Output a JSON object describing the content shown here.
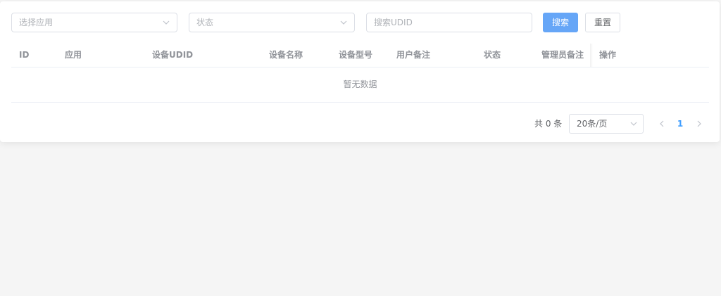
{
  "filters": {
    "app_select_placeholder": "选择应用",
    "status_select_placeholder": "状态",
    "udid_search_placeholder": "搜索UDID",
    "search_button": "搜索",
    "reset_button": "重置"
  },
  "table": {
    "columns": [
      "ID",
      "应用",
      "设备UDID",
      "设备名称",
      "设备型号",
      "用户备注",
      "状态",
      "管理员备注",
      "操作"
    ],
    "empty_text": "暂无数据"
  },
  "pagination": {
    "total_text": "共 0 条",
    "page_size": "20条/页",
    "current_page": "1"
  },
  "colors": {
    "primary": "#409eff",
    "primary_button": "#66a6f7",
    "border": "#dcdfe6",
    "page_background": "#f5f5f5"
  },
  "icons": {
    "select_arrow": "chevron-down-icon",
    "prev_page": "chevron-left-icon",
    "next_page": "chevron-right-icon"
  }
}
